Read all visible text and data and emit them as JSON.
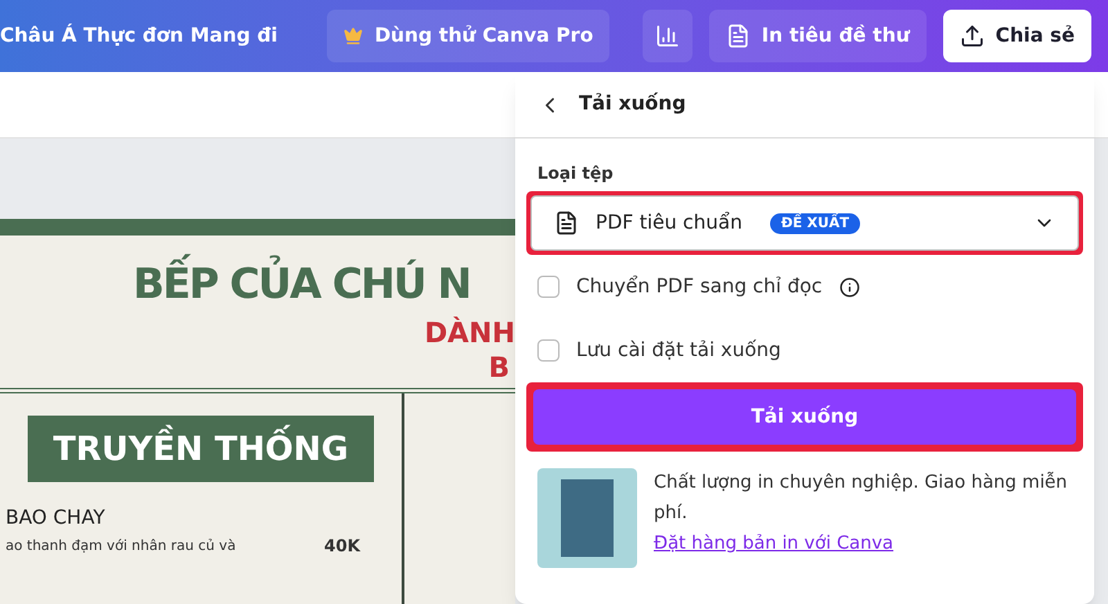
{
  "top_bar": {
    "title": "Châu Á Thực đơn Mang đi",
    "pro_button": "Dùng thử Canva Pro",
    "print_button": "In tiêu đề thư",
    "share_button": "Chia sẻ"
  },
  "menu_design": {
    "headline": "BẾP CỦA CHÚ N",
    "subtitle_lines": [
      "DÀNH",
      "B"
    ],
    "section_banner": "TRUYỀN THỐNG",
    "item_name": "BAO CHAY",
    "item_description": "ao thanh đạm với nhân rau củ và",
    "item_price": "40K"
  },
  "download_panel": {
    "title": "Tải xuống",
    "file_type_label": "Loại tệp",
    "file_type": {
      "value": "PDF tiêu chuẩn",
      "badge": "ĐỀ XUẤT",
      "highlighted": true
    },
    "options": [
      {
        "label": "Chuyển PDF sang chỉ đọc",
        "checked": false,
        "info": true
      },
      {
        "label": "Lưu cài đặt tải xuống",
        "checked": false,
        "info": false
      }
    ],
    "download_button": {
      "label": "Tải xuống",
      "highlighted": true
    },
    "promo": {
      "text": "Chất lượng in chuyên nghiệp. Giao hàng miễn phí.",
      "link": "Đặt hàng bản in với Canva"
    }
  }
}
